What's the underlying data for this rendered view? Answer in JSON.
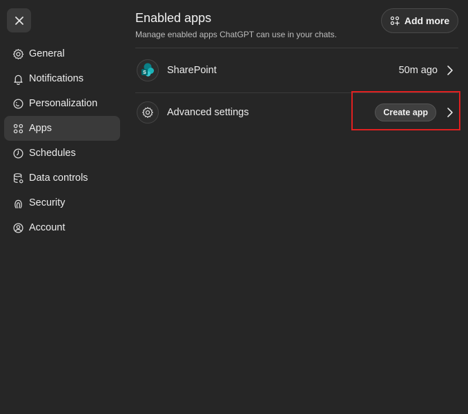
{
  "sidebar": {
    "items": [
      {
        "label": "General",
        "icon": "gear-icon"
      },
      {
        "label": "Notifications",
        "icon": "bell-icon"
      },
      {
        "label": "Personalization",
        "icon": "personalization-icon"
      },
      {
        "label": "Apps",
        "icon": "apps-grid-icon",
        "active": true
      },
      {
        "label": "Schedules",
        "icon": "clock-icon"
      },
      {
        "label": "Data controls",
        "icon": "database-icon"
      },
      {
        "label": "Security",
        "icon": "security-icon"
      },
      {
        "label": "Account",
        "icon": "account-icon"
      }
    ]
  },
  "main": {
    "title": "Enabled apps",
    "subtitle": "Manage enabled apps ChatGPT can use in your chats.",
    "add_more_label": "Add more",
    "rows": [
      {
        "label": "SharePoint",
        "meta": "50m ago",
        "icon": "sharepoint-icon"
      },
      {
        "label": "Advanced settings",
        "button": "Create app",
        "icon": "gear-icon"
      }
    ]
  },
  "colors": {
    "background": "#262626",
    "surface": "#3a3a3a",
    "highlight": "#e02020",
    "sharepoint_teal": "#0a9b9b"
  }
}
